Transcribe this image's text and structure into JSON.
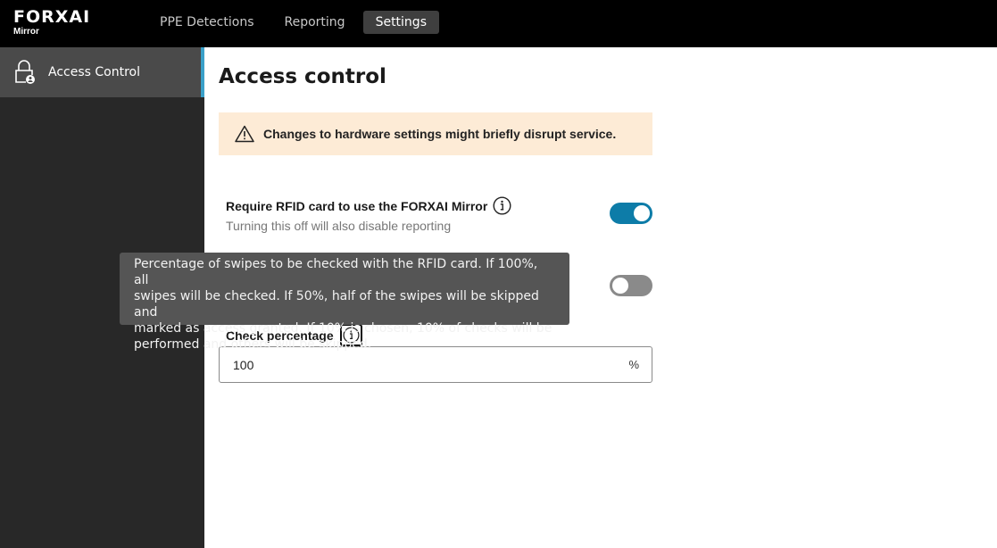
{
  "header": {
    "logo_main": "FORXAI",
    "logo_sub": "Mirror",
    "tabs": [
      {
        "label": "PPE Detections"
      },
      {
        "label": "Reporting"
      },
      {
        "label": "Settings"
      }
    ],
    "active_tab": "Settings"
  },
  "sidebar": {
    "items": [
      {
        "label": "Access Control",
        "icon": "lock-user-icon"
      }
    ]
  },
  "main": {
    "title": "Access control",
    "warning": {
      "icon": "warning-icon",
      "text": "Changes to hardware settings might briefly disrupt service."
    },
    "rfid_setting": {
      "title": "Require RFID card to use the FORXAI Mirror",
      "description": "Turning this off will also disable reporting",
      "enabled": true
    },
    "second_setting": {
      "enabled": false
    },
    "check_percentage": {
      "label": "Check percentage",
      "value": "100",
      "suffix": "%"
    },
    "tooltip": {
      "lines": [
        "Percentage of swipes to be checked with the RFID card. If 100%, all",
        "swipes will be checked. If 50%, half of the swipes will be skipped and",
        "marked as access granted. If 10% is chosen, 10% of checks will be",
        "performed and others will be skipped."
      ]
    }
  },
  "colors": {
    "accent": "#0d7ca8",
    "sidebar_active_border": "#3aa0c9",
    "warning_bg": "#fdebd6"
  }
}
